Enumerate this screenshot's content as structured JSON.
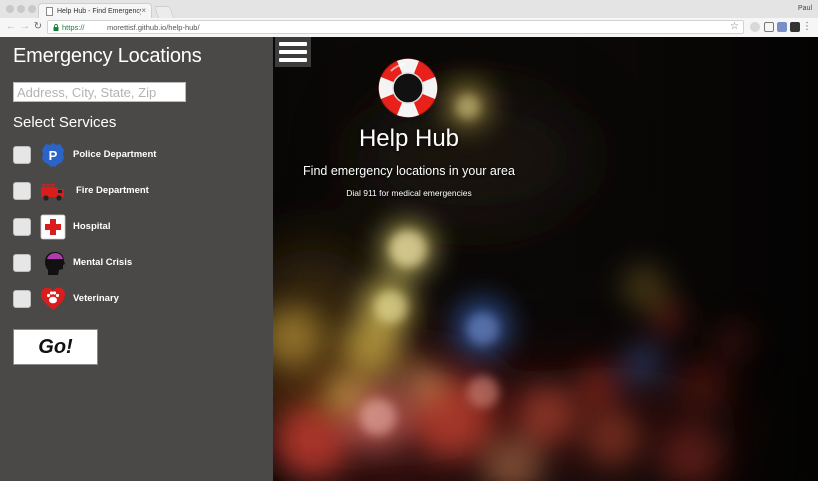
{
  "browser": {
    "tab_title": "Help Hub - Find Emergency Lo",
    "url_https": "https://",
    "url_rest": "morettisf.github.io/help-hub/",
    "user": "Paul"
  },
  "sidebar": {
    "title": "Emergency Locations",
    "search_placeholder": "Address, City, State, Zip",
    "services_title": "Select Services",
    "services": [
      {
        "label": "Police Department",
        "icon": "police-badge-icon"
      },
      {
        "label": "Fire Department",
        "icon": "fire-truck-icon"
      },
      {
        "label": "Hospital",
        "icon": "hospital-cross-icon"
      },
      {
        "label": "Mental Crisis",
        "icon": "head-silhouette-icon"
      },
      {
        "label": "Veterinary",
        "icon": "paw-heart-icon"
      }
    ],
    "go_label": "Go!"
  },
  "hero": {
    "title": "Help Hub",
    "subtitle": "Find emergency locations in your area",
    "note": "Dial 911 for medical emergencies"
  },
  "colors": {
    "sidebar_bg": "#4a4948",
    "hero_bg": "#050505",
    "lifebuoy_red": "#e8221a"
  }
}
